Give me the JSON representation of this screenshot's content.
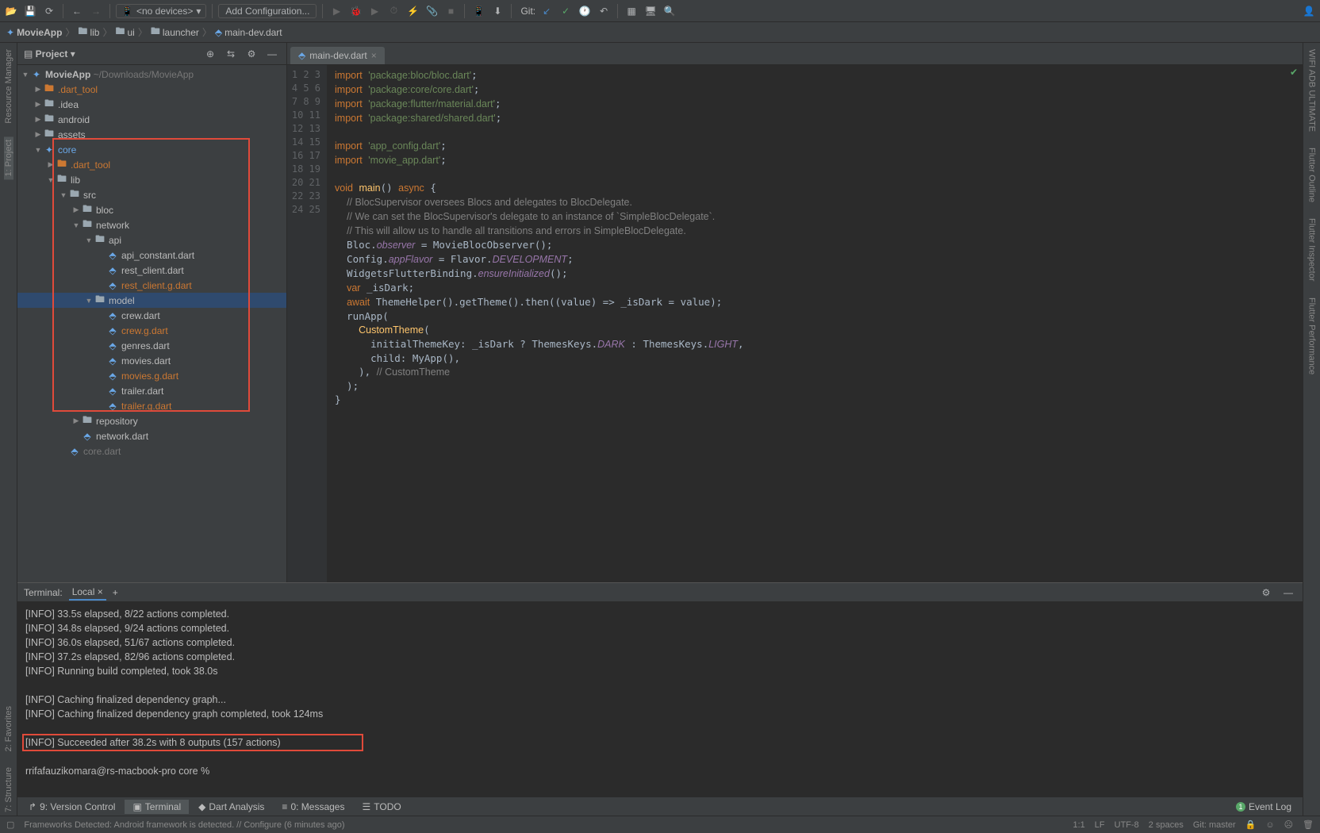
{
  "toolbar": {
    "device_label": "<no devices>",
    "add_conf": "Add Configuration...",
    "git_label": "Git:"
  },
  "breadcrumb": [
    "MovieApp",
    "lib",
    "ui",
    "launcher",
    "main-dev.dart"
  ],
  "left_gutter": [
    "Resource Manager",
    "1: Project"
  ],
  "right_gutter": [
    "WIFI ADB ULTIMATE",
    "Flutter Outline",
    "Flutter Inspector",
    "Flutter Performance"
  ],
  "project_panel": {
    "title": "Project",
    "root": "MovieApp",
    "root_path": "~/Downloads/MovieApp",
    "tree": [
      {
        "d": 0,
        "arrow": "▶",
        "ico": "fo",
        "label": ".dart_tool",
        "orange": true
      },
      {
        "d": 0,
        "arrow": "▶",
        "ico": "f",
        "label": ".idea"
      },
      {
        "d": 0,
        "arrow": "▶",
        "ico": "f",
        "label": "android"
      },
      {
        "d": 0,
        "arrow": "▶",
        "ico": "f",
        "label": "assets"
      },
      {
        "d": 0,
        "arrow": "▼",
        "ico": "fl",
        "label": "core"
      },
      {
        "d": 1,
        "arrow": "▶",
        "ico": "fo",
        "label": ".dart_tool",
        "orange": true
      },
      {
        "d": 1,
        "arrow": "▼",
        "ico": "f",
        "label": "lib"
      },
      {
        "d": 2,
        "arrow": "▼",
        "ico": "f",
        "label": "src"
      },
      {
        "d": 3,
        "arrow": "▶",
        "ico": "f",
        "label": "bloc"
      },
      {
        "d": 3,
        "arrow": "▼",
        "ico": "f",
        "label": "network"
      },
      {
        "d": 4,
        "arrow": "▼",
        "ico": "f",
        "label": "api"
      },
      {
        "d": 5,
        "arrow": "",
        "ico": "d",
        "label": "api_constant.dart"
      },
      {
        "d": 5,
        "arrow": "",
        "ico": "d",
        "label": "rest_client.dart"
      },
      {
        "d": 5,
        "arrow": "",
        "ico": "d",
        "label": "rest_client.g.dart",
        "gen": true
      },
      {
        "d": 4,
        "arrow": "▼",
        "ico": "f",
        "label": "model",
        "sel": true
      },
      {
        "d": 5,
        "arrow": "",
        "ico": "d",
        "label": "crew.dart"
      },
      {
        "d": 5,
        "arrow": "",
        "ico": "d",
        "label": "crew.g.dart",
        "gen": true
      },
      {
        "d": 5,
        "arrow": "",
        "ico": "d",
        "label": "genres.dart"
      },
      {
        "d": 5,
        "arrow": "",
        "ico": "d",
        "label": "movies.dart"
      },
      {
        "d": 5,
        "arrow": "",
        "ico": "d",
        "label": "movies.g.dart",
        "gen": true
      },
      {
        "d": 5,
        "arrow": "",
        "ico": "d",
        "label": "trailer.dart"
      },
      {
        "d": 5,
        "arrow": "",
        "ico": "d",
        "label": "trailer.g.dart",
        "gen": true
      },
      {
        "d": 3,
        "arrow": "▶",
        "ico": "f",
        "label": "repository"
      },
      {
        "d": 3,
        "arrow": "",
        "ico": "d",
        "label": "network.dart"
      },
      {
        "d": 2,
        "arrow": "",
        "ico": "d",
        "label": "core.dart",
        "faded": true
      }
    ]
  },
  "editor_tab": "main-dev.dart",
  "code_lines": [
    {
      "n": 1,
      "h": "<span class='kw'>import</span> <span class='str'>'package:bloc/bloc.dart'</span>;"
    },
    {
      "n": 2,
      "h": "<span class='kw'>import</span> <span class='str'>'package:core/core.dart'</span>;"
    },
    {
      "n": 3,
      "h": "<span class='kw'>import</span> <span class='str'>'package:flutter/material.dart'</span>;"
    },
    {
      "n": 4,
      "h": "<span class='kw'>import</span> <span class='str'>'package:shared/shared.dart'</span>;"
    },
    {
      "n": 5,
      "h": ""
    },
    {
      "n": 6,
      "h": "<span class='kw'>import</span> <span class='str'>'app_config.dart'</span>;"
    },
    {
      "n": 7,
      "h": "<span class='kw'>import</span> <span class='str'>'movie_app.dart'</span>;"
    },
    {
      "n": 8,
      "h": ""
    },
    {
      "n": 9,
      "h": "<span class='kw'>void</span> <span class='cls'>main</span>() <span class='kw'>async</span> {"
    },
    {
      "n": 10,
      "h": "  <span class='cmt'>// BlocSupervisor oversees Blocs and delegates to BlocDelegate.</span>"
    },
    {
      "n": 11,
      "h": "  <span class='cmt'>// We can set the BlocSupervisor's delegate to an instance of `SimpleBlocDelegate`.</span>"
    },
    {
      "n": 12,
      "h": "  <span class='cmt'>// This will allow us to handle all transitions and errors in SimpleBlocDelegate.</span>"
    },
    {
      "n": 13,
      "h": "  Bloc.<span class='fld'>observer</span> = MovieBlocObserver();"
    },
    {
      "n": 14,
      "h": "  Config.<span class='fld'>appFlavor</span> = Flavor.<span class='fld'>DEVELOPMENT</span>;"
    },
    {
      "n": 15,
      "h": "  WidgetsFlutterBinding.<span class='fld'>ensureInitialized</span>();"
    },
    {
      "n": 16,
      "h": "  <span class='kw'>var</span> _isDark;"
    },
    {
      "n": 17,
      "h": "  <span class='kw'>await</span> ThemeHelper().getTheme().then((value) =&gt; _isDark = value);"
    },
    {
      "n": 18,
      "h": "  runApp("
    },
    {
      "n": 19,
      "h": "    <span class='cls'>CustomTheme</span>("
    },
    {
      "n": 20,
      "h": "      initialThemeKey: _isDark ? ThemesKeys.<span class='fld'>DARK</span> : ThemesKeys.<span class='fld'>LIGHT</span>,"
    },
    {
      "n": 21,
      "h": "      child: MyApp(),"
    },
    {
      "n": 22,
      "h": "    ), <span class='cmt'>// CustomTheme</span>"
    },
    {
      "n": 23,
      "h": "  );"
    },
    {
      "n": 24,
      "h": "}"
    },
    {
      "n": 25,
      "h": ""
    }
  ],
  "terminal": {
    "title": "Terminal:",
    "tab": "Local",
    "lines": [
      "[INFO] 33.5s elapsed, 8/22 actions completed.",
      "[INFO] 34.8s elapsed, 9/24 actions completed.",
      "[INFO] 36.0s elapsed, 51/67 actions completed.",
      "[INFO] 37.2s elapsed, 82/96 actions completed.",
      "[INFO] Running build completed, took 38.0s",
      "",
      "[INFO] Caching finalized dependency graph...",
      "[INFO] Caching finalized dependency graph completed, took 124ms",
      "",
      "[INFO] Succeeded after 38.2s with 8 outputs (157 actions)",
      "",
      "rrifafauzikomara@rs-macbook-pro core % "
    ]
  },
  "left_gutter2": [
    "2: Favorites",
    "7: Structure"
  ],
  "bottom_tools": {
    "version_control": "9: Version Control",
    "terminal": "Terminal",
    "dart_analysis": "Dart Analysis",
    "messages": "0: Messages",
    "todo": "TODO",
    "event_log": "Event Log"
  },
  "statusbar": {
    "msg": "Frameworks Detected: Android framework is detected. // Configure (6 minutes ago)",
    "pos": "1:1",
    "le": "LF",
    "enc": "UTF-8",
    "indent": "2 spaces",
    "git": "Git: master"
  }
}
